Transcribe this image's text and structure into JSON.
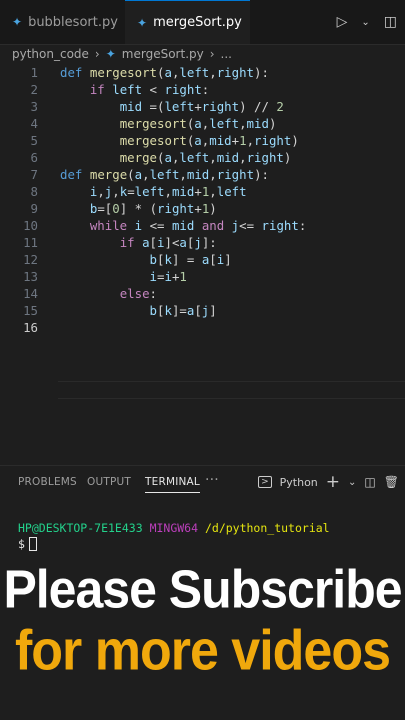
{
  "tabs": [
    {
      "label": "bubblesort.py",
      "active": false
    },
    {
      "label": "mergeSort.py",
      "active": true,
      "modified": true
    }
  ],
  "breadcrumb": {
    "folder": "python_code",
    "file": "mergeSort.py",
    "more": "..."
  },
  "editor": {
    "lines": [
      {
        "n": "1",
        "code": "def mergesort(a,left,right):"
      },
      {
        "n": "2",
        "code": "    if left < right:"
      },
      {
        "n": "3",
        "code": "        mid =(left+right) // 2"
      },
      {
        "n": "4",
        "code": "        mergesort(a,left,mid)"
      },
      {
        "n": "5",
        "code": "        mergesort(a,mid+1,right)"
      },
      {
        "n": "6",
        "code": "        merge(a,left,mid,right)"
      },
      {
        "n": "7",
        "code": "def merge(a,left,mid,right):"
      },
      {
        "n": "8",
        "code": "    i,j,k=left,mid+1,left"
      },
      {
        "n": "9",
        "code": "    b=[0] * (right+1)"
      },
      {
        "n": "10",
        "code": "    while i <= mid and j<= right:"
      },
      {
        "n": "11",
        "code": "        if a[i]<a[j]:"
      },
      {
        "n": "12",
        "code": "            b[k] = a[i]"
      },
      {
        "n": "13",
        "code": "            i=i+1"
      },
      {
        "n": "14",
        "code": "        else:"
      },
      {
        "n": "15",
        "code": "            b[k]=a[j]"
      },
      {
        "n": "16",
        "code": ""
      }
    ]
  },
  "panel": {
    "tabs": [
      "PROBLEMS",
      "OUTPUT",
      "TERMINAL"
    ],
    "active_tab": "TERMINAL",
    "more": "···",
    "shell": "Python"
  },
  "terminal": {
    "user": "HP@DESKTOP-7E1E433",
    "system": "MINGW64",
    "path": "/d/python_tutorial",
    "prompt": "$"
  },
  "overlay": {
    "line1": "Please Subscribe",
    "line2": "for more videos"
  },
  "icons": [
    "run-icon",
    "chevron-down-icon",
    "more-icon",
    "split-icon",
    "plus-icon",
    "trash-icon",
    "panel-layout-icon"
  ]
}
